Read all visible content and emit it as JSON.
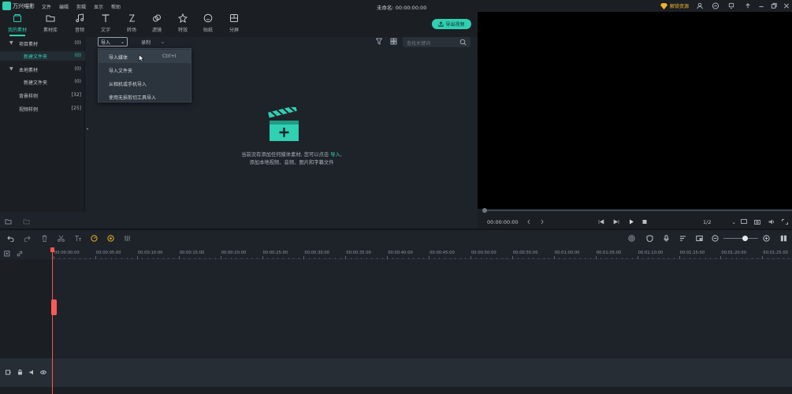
{
  "titlebar": {
    "app_name": "万兴喵影",
    "menu": [
      "文件",
      "编辑",
      "剪辑",
      "显示",
      "帮助"
    ],
    "doc_title": "未命名: 00:00:00:00",
    "unlock_label": "解锁资源"
  },
  "toolbar": {
    "items": [
      {
        "label": "我的素材",
        "icon": "my-media-icon",
        "active": true
      },
      {
        "label": "素材库",
        "icon": "folder-icon"
      },
      {
        "label": "音频",
        "icon": "music-note-icon"
      },
      {
        "label": "文字",
        "icon": "text-icon"
      },
      {
        "label": "转场",
        "icon": "transition-icon"
      },
      {
        "label": "滤镜",
        "icon": "filter-icon"
      },
      {
        "label": "特效",
        "icon": "effects-icon"
      },
      {
        "label": "贴纸",
        "icon": "sticker-icon"
      },
      {
        "label": "分屏",
        "icon": "split-screen-icon"
      }
    ],
    "export_label": "导出视频"
  },
  "tree": {
    "items": [
      {
        "label": "项目素材",
        "count": "(0)",
        "expanded": true
      },
      {
        "label": "新建文件夹",
        "count": "(0)",
        "selected": true
      },
      {
        "label": "本地素材",
        "count": "(0)",
        "expanded": true
      },
      {
        "label": "新建文件夹",
        "count": "(0)"
      },
      {
        "label": "背景样例",
        "count": "[32]"
      },
      {
        "label": "视频样例",
        "count": "[25]"
      }
    ]
  },
  "media": {
    "import_label": "导入",
    "record_label": "录制",
    "search_placeholder": "查找关键词",
    "import_menu": [
      {
        "label": "导入媒体",
        "shortcut": "Ctrl+I"
      },
      {
        "label": "导入文件夹",
        "shortcut": ""
      },
      {
        "label": "从相机或手机导入",
        "shortcut": ""
      },
      {
        "label": "使用无损剪切工具导入",
        "shortcut": ""
      }
    ],
    "empty_line1": "当前没有添加任何媒体素材, 您可以点击",
    "empty_link": "导入",
    "empty_line1_end": ",",
    "empty_line2": "添加本地视频、音频、图片和字幕文件"
  },
  "preview": {
    "timecode": "00:00:00:00",
    "ratio": "1/2"
  },
  "timeline": {
    "ruler_labels": [
      "00:00:00:00",
      "00:00:05:00",
      "00:00:10:00",
      "00:00:15:00",
      "00:00:20:00",
      "00:00:25:00",
      "00:00:30:00",
      "00:00:35:00",
      "00:00:40:00",
      "00:00:45:00",
      "00:00:50:00",
      "00:00:55:00",
      "00:01:00:00",
      "00:01:05:00",
      "00:01:10:00",
      "00:01:15:00",
      "00:01:20:00",
      "00:01:25:00"
    ]
  },
  "colors": {
    "accent": "#30d0b2",
    "playhead": "#ff5555",
    "unlock": "#f0b429"
  }
}
